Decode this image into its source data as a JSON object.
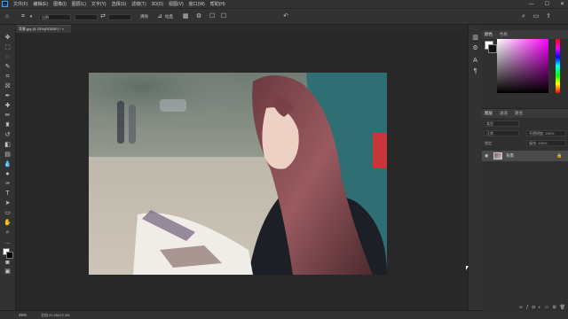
{
  "app": {
    "logo": "Ps"
  },
  "menu": [
    "文件(F)",
    "编辑(E)",
    "图像(I)",
    "图层(L)",
    "文字(Y)",
    "选择(S)",
    "滤镜(T)",
    "3D(D)",
    "视图(V)",
    "窗口(W)",
    "帮助(H)"
  ],
  "window_controls": [
    "—",
    "☐",
    "✕"
  ],
  "options_bar": {
    "ratio_label": "比例",
    "clear_label": "清除",
    "straighten_label": "拉直",
    "delete_cropped_label": "删除裁剪的像素",
    "content_aware_label": "内容识别"
  },
  "document_tab": {
    "title": "背景.jpg @ 25%(RGB/8*) *  ×"
  },
  "status": {
    "zoom": "25%",
    "doc_info": "文档:22.2M/22.2M"
  },
  "panels": {
    "color_tabs": [
      "颜色",
      "色板"
    ],
    "layer_tabs": [
      "图层",
      "通道",
      "路径"
    ],
    "kind_label": "类型",
    "mode_label": "正常",
    "opacity_label": "不透明度: 100%",
    "lock_label": "锁定:",
    "fill_label": "填充: 100%",
    "layer_name": "背景"
  },
  "colors": {
    "accent": "#31a8ff",
    "panel": "#323232",
    "workspace": "#282828"
  }
}
